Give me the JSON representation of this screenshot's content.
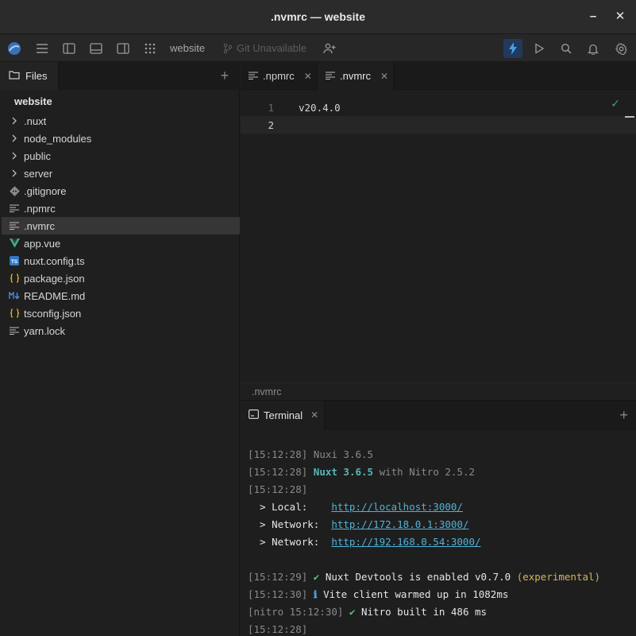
{
  "window": {
    "title": ".nvmrc — website",
    "minimize": "–",
    "close": "✕"
  },
  "toolbar": {
    "project": "website",
    "git_status": "Git Unavailable"
  },
  "sidebar": {
    "tab_label": "Files",
    "root": "website",
    "items": [
      {
        "label": ".nuxt",
        "icon": "chevron-right-icon",
        "kind": "folder"
      },
      {
        "label": "node_modules",
        "icon": "chevron-right-icon",
        "kind": "folder"
      },
      {
        "label": "public",
        "icon": "chevron-right-icon",
        "kind": "folder"
      },
      {
        "label": "server",
        "icon": "chevron-right-icon",
        "kind": "folder"
      },
      {
        "label": ".gitignore",
        "icon": "git-icon",
        "kind": "file"
      },
      {
        "label": ".npmrc",
        "icon": "text-file-icon",
        "kind": "file"
      },
      {
        "label": ".nvmrc",
        "icon": "text-file-icon",
        "kind": "file",
        "selected": true
      },
      {
        "label": "app.vue",
        "icon": "vue-icon",
        "kind": "file"
      },
      {
        "label": "nuxt.config.ts",
        "icon": "typescript-icon",
        "kind": "file"
      },
      {
        "label": "package.json",
        "icon": "json-icon",
        "kind": "file"
      },
      {
        "label": "README.md",
        "icon": "markdown-icon",
        "kind": "file"
      },
      {
        "label": "tsconfig.json",
        "icon": "json-icon",
        "kind": "file"
      },
      {
        "label": "yarn.lock",
        "icon": "text-file-icon",
        "kind": "file"
      }
    ]
  },
  "editor": {
    "tabs": [
      {
        "label": ".npmrc",
        "active": false
      },
      {
        "label": ".nvmrc",
        "active": true
      }
    ],
    "lines": [
      {
        "num": "1",
        "text": "v20.4.0"
      },
      {
        "num": "2",
        "text": ""
      }
    ],
    "status_path": ".nvmrc"
  },
  "terminal": {
    "tab_label": "Terminal",
    "lines": [
      {
        "ts": "[15:12:28]",
        "parts": [
          {
            "t": " Nuxi 3.6.5",
            "c": "dim"
          }
        ]
      },
      {
        "ts": "[15:12:28]",
        "parts": [
          {
            "t": " Nuxt 3.6.5",
            "c": "cyan"
          },
          {
            "t": " with Nitro 2.5.2",
            "c": "dim"
          }
        ]
      },
      {
        "ts": "[15:12:28]",
        "parts": []
      },
      {
        "ts": "",
        "parts": [
          {
            "t": "  > Local:    ",
            "c": "bold"
          },
          {
            "t": "http://localhost:3000/",
            "c": "link"
          }
        ]
      },
      {
        "ts": "",
        "parts": [
          {
            "t": "  > Network:  ",
            "c": "bold"
          },
          {
            "t": "http://172.18.0.1:3000/",
            "c": "link"
          }
        ]
      },
      {
        "ts": "",
        "parts": [
          {
            "t": "  > Network:  ",
            "c": "bold"
          },
          {
            "t": "http://192.168.0.54:3000/",
            "c": "link"
          }
        ]
      },
      {
        "ts": "",
        "parts": []
      },
      {
        "ts": "[15:12:29]",
        "parts": [
          {
            "t": " ✔",
            "c": "green"
          },
          {
            "t": " Nuxt Devtools is enabled v0.7.0 ",
            "c": "bold"
          },
          {
            "t": "(experimental)",
            "c": "yellow"
          }
        ]
      },
      {
        "ts": "[15:12:30]",
        "parts": [
          {
            "t": " ℹ",
            "c": "blue"
          },
          {
            "t": " Vite client warmed up in 1082ms",
            "c": "bold"
          }
        ]
      },
      {
        "ts": "[nitro 15:12:30]",
        "parts": [
          {
            "t": " ✔",
            "c": "green"
          },
          {
            "t": " Nitro built in 486 ms",
            "c": "bold"
          }
        ]
      },
      {
        "ts": "[15:12:28]",
        "parts": []
      }
    ]
  }
}
